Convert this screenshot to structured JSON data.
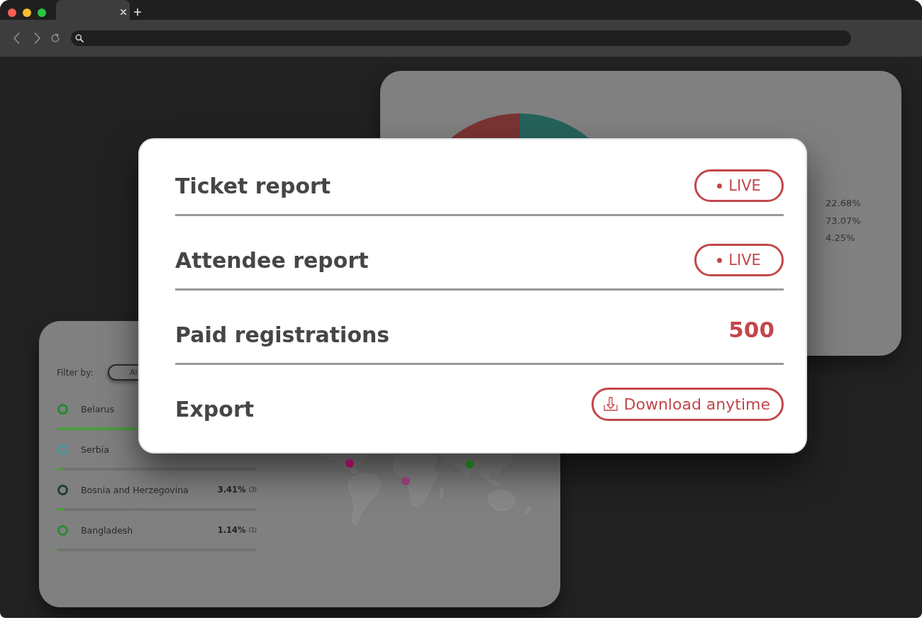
{
  "browser": {
    "tabs": [
      {
        "selected": true
      }
    ]
  },
  "chart_card": {
    "legend_values": [
      "22.68%",
      "73.07%",
      "4.25%"
    ]
  },
  "countries_card": {
    "filter": {
      "label": "Filter by:",
      "value": "Al"
    },
    "countries": [
      {
        "name": "Belarus",
        "color": "#1f8a2f",
        "level": 1
      },
      {
        "name": "Serbia",
        "color": "#4a9aa4",
        "level": 0.03
      },
      {
        "name": "Bosnia and Herzegovina",
        "color": "#1e3a3a",
        "level": 0.0341,
        "percent": "3.41%",
        "count": "(3)"
      },
      {
        "name": "Bangladesh",
        "color": "#2a8a2a",
        "level": 0.0114,
        "percent": "1.14%",
        "count": "(1)"
      }
    ],
    "map_markers": [
      {
        "color": "#8b0b57"
      },
      {
        "color": "#8c3c72"
      },
      {
        "color": "#1b6b1b"
      }
    ]
  },
  "report_card": {
    "rows": [
      {
        "kind": "status",
        "title": "Ticket report",
        "badge": "LIVE"
      },
      {
        "kind": "status",
        "title": "Attendee report",
        "badge": "LIVE"
      },
      {
        "kind": "value",
        "title": "Paid registrations",
        "value": "500"
      },
      {
        "kind": "action",
        "title": "Export",
        "button": "Download anytime"
      }
    ]
  }
}
